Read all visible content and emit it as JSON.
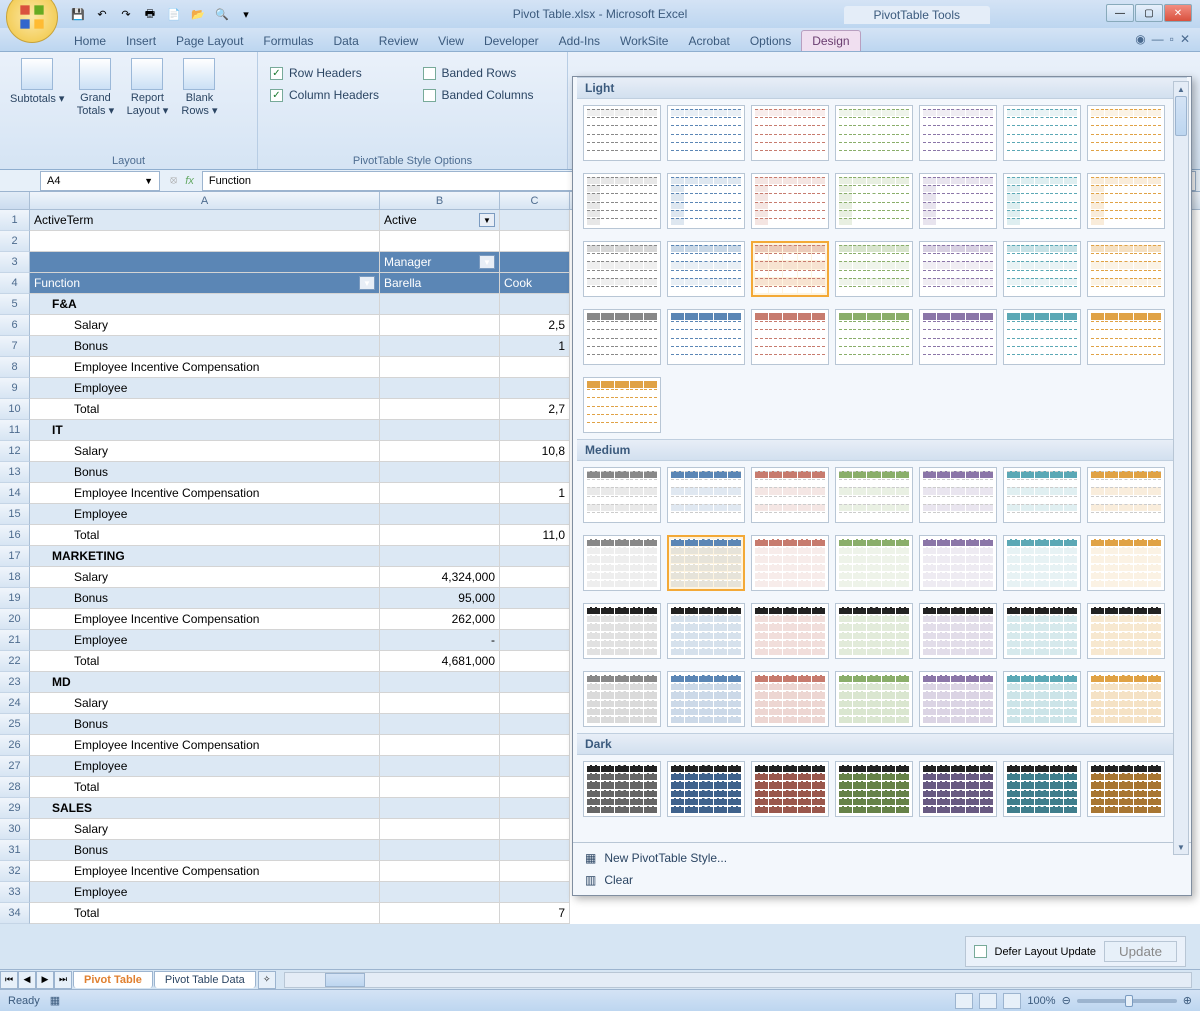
{
  "title": "Pivot Table.xlsx - Microsoft Excel",
  "contextual_tab_group": "PivotTable Tools",
  "tabs": [
    "Home",
    "Insert",
    "Page Layout",
    "Formulas",
    "Data",
    "Review",
    "View",
    "Developer",
    "Add-Ins",
    "WorkSite",
    "Acrobat",
    "Options",
    "Design"
  ],
  "active_tab": "Design",
  "ribbon": {
    "layout": {
      "label": "Layout",
      "buttons": [
        "Subtotals",
        "Grand Totals",
        "Report Layout",
        "Blank Rows"
      ]
    },
    "style_options": {
      "label": "PivotTable Style Options",
      "checks": [
        {
          "label": "Row Headers",
          "checked": true
        },
        {
          "label": "Banded Rows",
          "checked": false
        },
        {
          "label": "Column Headers",
          "checked": true
        },
        {
          "label": "Banded Columns",
          "checked": false
        }
      ]
    }
  },
  "name_box": "A4",
  "formula": "Function",
  "columns": [
    "A",
    "B",
    "C"
  ],
  "grid_rows": [
    {
      "n": 1,
      "a": "ActiveTerm",
      "b": "Active",
      "filter_b": true,
      "light": true
    },
    {
      "n": 2,
      "a": "",
      "b": ""
    },
    {
      "n": 3,
      "a": "",
      "b": "Manager",
      "filter_b": true,
      "blue": true
    },
    {
      "n": 4,
      "a": "Function",
      "b": "Barella",
      "c": "Cook",
      "filter_a": true,
      "blue": true
    },
    {
      "n": 5,
      "a": "F&A",
      "bold": true,
      "light": true,
      "indent": 1
    },
    {
      "n": 6,
      "a": "Salary",
      "b": "",
      "c": "2,5",
      "indent": 2
    },
    {
      "n": 7,
      "a": "Bonus",
      "b": "",
      "c": "1",
      "indent": 2,
      "light": true
    },
    {
      "n": 8,
      "a": "Employee Incentive Compensation",
      "indent": 2
    },
    {
      "n": 9,
      "a": "Employee",
      "indent": 2,
      "light": true
    },
    {
      "n": 10,
      "a": "Total",
      "b": "",
      "c": "2,7",
      "indent": 2
    },
    {
      "n": 11,
      "a": "IT",
      "bold": true,
      "light": true,
      "indent": 1
    },
    {
      "n": 12,
      "a": "Salary",
      "b": "",
      "c": "10,8",
      "indent": 2
    },
    {
      "n": 13,
      "a": "Bonus",
      "indent": 2,
      "light": true
    },
    {
      "n": 14,
      "a": "Employee Incentive Compensation",
      "c": "1",
      "indent": 2
    },
    {
      "n": 15,
      "a": "Employee",
      "indent": 2,
      "light": true
    },
    {
      "n": 16,
      "a": "Total",
      "b": "",
      "c": "11,0",
      "indent": 2
    },
    {
      "n": 17,
      "a": "MARKETING",
      "bold": true,
      "light": true,
      "indent": 1
    },
    {
      "n": 18,
      "a": "Salary",
      "b": "4,324,000",
      "indent": 2
    },
    {
      "n": 19,
      "a": "Bonus",
      "b": "95,000",
      "indent": 2,
      "light": true
    },
    {
      "n": 20,
      "a": "Employee Incentive Compensation",
      "b": "262,000",
      "indent": 2
    },
    {
      "n": 21,
      "a": "Employee",
      "b": "-",
      "indent": 2,
      "light": true
    },
    {
      "n": 22,
      "a": "Total",
      "b": "4,681,000",
      "indent": 2
    },
    {
      "n": 23,
      "a": "MD",
      "bold": true,
      "light": true,
      "indent": 1
    },
    {
      "n": 24,
      "a": "Salary",
      "indent": 2
    },
    {
      "n": 25,
      "a": "Bonus",
      "indent": 2,
      "light": true
    },
    {
      "n": 26,
      "a": "Employee Incentive Compensation",
      "indent": 2
    },
    {
      "n": 27,
      "a": "Employee",
      "indent": 2,
      "light": true
    },
    {
      "n": 28,
      "a": "Total",
      "indent": 2
    },
    {
      "n": 29,
      "a": "SALES",
      "bold": true,
      "light": true,
      "indent": 1
    },
    {
      "n": 30,
      "a": "Salary",
      "indent": 2
    },
    {
      "n": 31,
      "a": "Bonus",
      "indent": 2,
      "light": true
    },
    {
      "n": 32,
      "a": "Employee Incentive Compensation",
      "indent": 2
    },
    {
      "n": 33,
      "a": "Employee",
      "indent": 2,
      "light": true
    },
    {
      "n": 34,
      "a": "Total",
      "c": "7",
      "indent": 2
    }
  ],
  "gallery": {
    "sections": [
      "Light",
      "Medium",
      "Dark"
    ],
    "footer": {
      "new_style": "New PivotTable Style...",
      "clear": "Clear"
    },
    "light_colors": [
      "#888888",
      "#5b86b5",
      "#c77b6e",
      "#8aae6a",
      "#8b76a8",
      "#5ba8b5",
      "#e0a245"
    ],
    "medium_colors": [
      "#888888",
      "#5b86b5",
      "#c77b6e",
      "#8aae6a",
      "#8b76a8",
      "#5ba8b5",
      "#e0a245"
    ],
    "dark_colors": [
      "#666666",
      "#3f628c",
      "#9a574c",
      "#668248",
      "#685a82",
      "#3f7e8c",
      "#a87632"
    ],
    "selected": {
      "section": "Light",
      "row": 2,
      "col": 2
    }
  },
  "sheet_tabs": [
    "Pivot Table",
    "Pivot Table Data"
  ],
  "active_sheet": "Pivot Table",
  "status": "Ready",
  "zoom": "100%",
  "defer": {
    "label": "Defer Layout Update",
    "button": "Update",
    "checked": false
  }
}
